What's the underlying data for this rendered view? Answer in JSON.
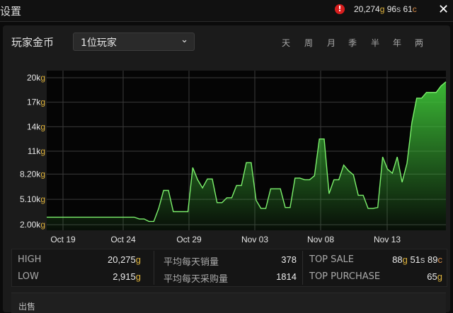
{
  "header": {
    "title": "设置",
    "alert_icon": "exclamation-icon",
    "gold": {
      "g": "20,274",
      "s": "96",
      "c": "61"
    },
    "close_icon": "close-icon"
  },
  "filters": {
    "section_label": "玩家金币",
    "player_dropdown": "1位玩家",
    "ranges": [
      "天",
      "周",
      "月",
      "季",
      "半",
      "年",
      "两"
    ]
  },
  "currency_suffix": "g",
  "chart_data": {
    "type": "area",
    "series": [
      {
        "values": [
          2915,
          2915,
          2915,
          2915,
          2915,
          2915,
          2915,
          2915,
          2915,
          2915,
          2915,
          2915,
          2915,
          2915,
          2915,
          2915,
          2915,
          2915,
          2915,
          2700,
          2700,
          2400,
          2400,
          4000,
          6200,
          6200,
          3600,
          3600,
          3600,
          3600,
          9000,
          7500,
          6500,
          7600,
          7600,
          4700,
          4700,
          5300,
          5300,
          6800,
          6800,
          9600,
          9600,
          5000,
          4000,
          4000,
          6400,
          6400,
          6400,
          4100,
          4100,
          7700,
          7700,
          7500,
          7500,
          8000,
          12500,
          12500,
          5800,
          7500,
          7500,
          9300,
          8600,
          8100,
          5600,
          5600,
          4000,
          4000,
          4100,
          10300,
          8800,
          8300,
          10300,
          7200,
          9500,
          14500,
          17500,
          17500,
          18200,
          18200,
          18200,
          19000,
          19500
        ]
      }
    ],
    "x_ticks": [
      "Oct 19",
      "Oct 24",
      "Oct 29",
      "Nov 03",
      "Nov 08",
      "Nov 13"
    ],
    "y_ticks": [
      "2.00k",
      "5.10k",
      "8.20k",
      "11k",
      "14k",
      "17k",
      "20k"
    ],
    "y_tick_values": [
      2000,
      5100,
      8200,
      11000,
      14000,
      17000,
      20000
    ],
    "ylim": [
      2000,
      20000
    ],
    "grid": true,
    "line_color": "#7cf06c",
    "fill_color": "#3ec238"
  },
  "stats": {
    "high": {
      "label": "HIGH",
      "g": "20,275"
    },
    "low": {
      "label": "LOW",
      "g": "2,915"
    },
    "avg_sold": {
      "label": "平均每天销量",
      "value": "378"
    },
    "avg_bought": {
      "label": "平均每天采购量",
      "value": "1814"
    },
    "top_sale": {
      "label": "TOP SALE",
      "g": "88",
      "s": "51",
      "c": "89"
    },
    "top_purchase": {
      "label": "TOP PURCHASE",
      "g": "65"
    }
  },
  "sell": {
    "label": "出售"
  }
}
